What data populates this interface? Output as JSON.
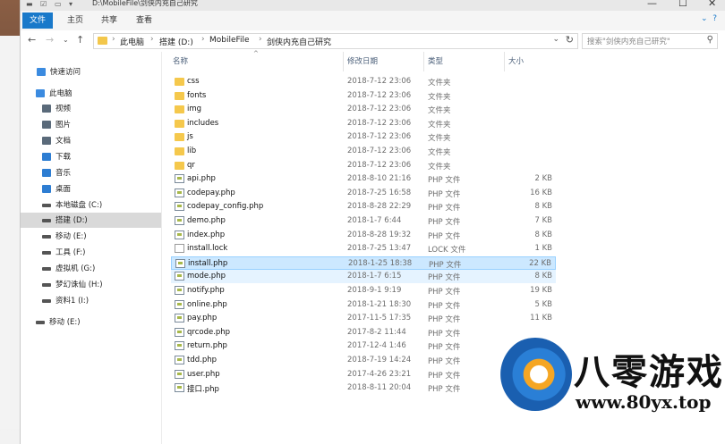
{
  "window": {
    "title_path": "D:\\MobileFile\\剑侠内充自己研究",
    "controls": [
      "—",
      "☐",
      "✕"
    ]
  },
  "ribbon": {
    "tabs": [
      "文件",
      "主页",
      "共享",
      "查看"
    ],
    "active_tab": "文件"
  },
  "address": {
    "crumbs": [
      "此电脑",
      "搭建 (D:)",
      "MobileFile",
      "剑侠内充自己研究"
    ]
  },
  "search": {
    "placeholder": "搜索\"剑侠内充自己研究\""
  },
  "sidebar": {
    "items": [
      {
        "label": "快速访问",
        "icon": "pin-icon",
        "color": "#3b8be0"
      },
      {
        "label": "此电脑",
        "icon": "computer-icon",
        "color": "#3b8be0"
      },
      {
        "label": "视频",
        "icon": "video-icon",
        "color": "#5a6a7a"
      },
      {
        "label": "图片",
        "icon": "pictures-icon",
        "color": "#5a6a7a"
      },
      {
        "label": "文档",
        "icon": "documents-icon",
        "color": "#5a6a7a"
      },
      {
        "label": "下载",
        "icon": "download-icon",
        "color": "#2d7dd2"
      },
      {
        "label": "音乐",
        "icon": "music-icon",
        "color": "#2d7dd2"
      },
      {
        "label": "桌面",
        "icon": "desktop-icon",
        "color": "#2d7dd2"
      },
      {
        "label": "本地磁盘 (C:)",
        "icon": "drive-icon",
        "color": "#555"
      },
      {
        "label": "搭建 (D:)",
        "icon": "drive-icon",
        "color": "#555"
      },
      {
        "label": "移动 (E:)",
        "icon": "drive-icon",
        "color": "#555"
      },
      {
        "label": "工具 (F:)",
        "icon": "drive-icon",
        "color": "#555"
      },
      {
        "label": "虚拟机 (G:)",
        "icon": "drive-icon",
        "color": "#555"
      },
      {
        "label": "梦幻诛仙 (H:)",
        "icon": "drive-icon",
        "color": "#555"
      },
      {
        "label": "资料1 (I:)",
        "icon": "drive-icon",
        "color": "#555"
      },
      {
        "label": "移动 (E:)",
        "icon": "drive-icon",
        "color": "#555"
      }
    ],
    "selected": "搭建 (D:)"
  },
  "columns": [
    "名称",
    "修改日期",
    "类型",
    "大小"
  ],
  "files": [
    {
      "name": "css",
      "date": "2018-7-12 23:06",
      "type": "文件夹",
      "size": "",
      "kind": "folder"
    },
    {
      "name": "fonts",
      "date": "2018-7-12 23:06",
      "type": "文件夹",
      "size": "",
      "kind": "folder"
    },
    {
      "name": "img",
      "date": "2018-7-12 23:06",
      "type": "文件夹",
      "size": "",
      "kind": "folder"
    },
    {
      "name": "includes",
      "date": "2018-7-12 23:06",
      "type": "文件夹",
      "size": "",
      "kind": "folder"
    },
    {
      "name": "js",
      "date": "2018-7-12 23:06",
      "type": "文件夹",
      "size": "",
      "kind": "folder"
    },
    {
      "name": "lib",
      "date": "2018-7-12 23:06",
      "type": "文件夹",
      "size": "",
      "kind": "folder"
    },
    {
      "name": "qr",
      "date": "2018-7-12 23:06",
      "type": "文件夹",
      "size": "",
      "kind": "folder"
    },
    {
      "name": "api.php",
      "date": "2018-8-10 21:16",
      "type": "PHP 文件",
      "size": "2 KB",
      "kind": "php"
    },
    {
      "name": "codepay.php",
      "date": "2018-7-25 16:58",
      "type": "PHP 文件",
      "size": "16 KB",
      "kind": "php"
    },
    {
      "name": "codepay_config.php",
      "date": "2018-8-28 22:29",
      "type": "PHP 文件",
      "size": "8 KB",
      "kind": "php"
    },
    {
      "name": "demo.php",
      "date": "2018-1-7 6:44",
      "type": "PHP 文件",
      "size": "7 KB",
      "kind": "php"
    },
    {
      "name": "index.php",
      "date": "2018-8-28 19:32",
      "type": "PHP 文件",
      "size": "8 KB",
      "kind": "php"
    },
    {
      "name": "install.lock",
      "date": "2018-7-25 13:47",
      "type": "LOCK 文件",
      "size": "1 KB",
      "kind": "file"
    },
    {
      "name": "install.php",
      "date": "2018-1-25 18:38",
      "type": "PHP 文件",
      "size": "22 KB",
      "kind": "php"
    },
    {
      "name": "mode.php",
      "date": "2018-1-7 6:15",
      "type": "PHP 文件",
      "size": "8 KB",
      "kind": "php"
    },
    {
      "name": "notify.php",
      "date": "2018-9-1 9:19",
      "type": "PHP 文件",
      "size": "19 KB",
      "kind": "php"
    },
    {
      "name": "online.php",
      "date": "2018-1-21 18:30",
      "type": "PHP 文件",
      "size": "5 KB",
      "kind": "php"
    },
    {
      "name": "pay.php",
      "date": "2017-11-5 17:35",
      "type": "PHP 文件",
      "size": "11 KB",
      "kind": "php"
    },
    {
      "name": "qrcode.php",
      "date": "2017-8-2 11:44",
      "type": "PHP 文件",
      "size": "",
      "kind": "php"
    },
    {
      "name": "return.php",
      "date": "2017-12-4 1:46",
      "type": "PHP 文件",
      "size": "",
      "kind": "php"
    },
    {
      "name": "tdd.php",
      "date": "2018-7-19 14:24",
      "type": "PHP 文件",
      "size": "",
      "kind": "php"
    },
    {
      "name": "user.php",
      "date": "2017-4-26 23:21",
      "type": "PHP 文件",
      "size": "",
      "kind": "php"
    },
    {
      "name": "接口.php",
      "date": "2018-8-11 20:04",
      "type": "PHP 文件",
      "size": "",
      "kind": "php"
    }
  ],
  "selected_file": "install.php",
  "hover_file": "mode.php",
  "watermark": {
    "text": "八零游戏",
    "url": "www.80yx.top"
  }
}
